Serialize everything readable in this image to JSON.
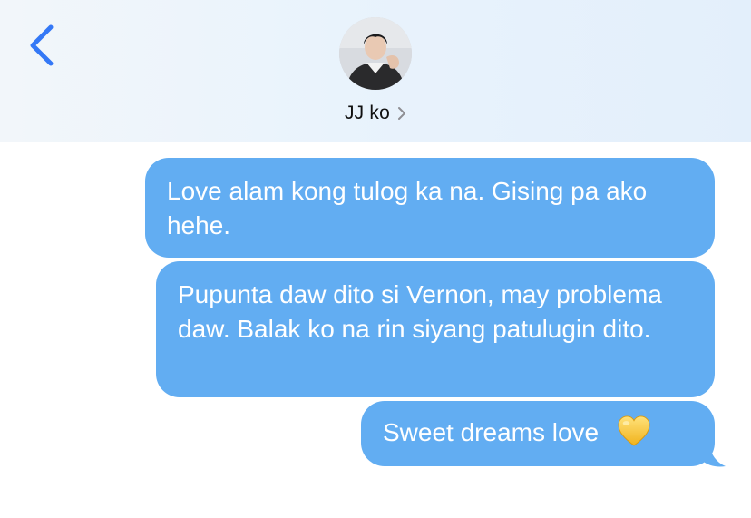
{
  "header": {
    "contact_name": "JJ ko",
    "back_icon": "chevron-left-icon",
    "details_icon": "chevron-right-icon",
    "accent_color": "#3478f6"
  },
  "messages": [
    {
      "direction": "outgoing",
      "text": "Love alam kong tulog ka na. Gising pa ako hehe."
    },
    {
      "direction": "outgoing",
      "text": "Pupunta daw dito si Vernon, may problema daw. Balak ko na rin siyang patulugin dito."
    },
    {
      "direction": "outgoing",
      "text": "Sweet dreams love",
      "emoji": "yellow-heart-icon"
    }
  ],
  "colors": {
    "bubble": "#62adf2",
    "bubble_text": "#ffffff"
  }
}
